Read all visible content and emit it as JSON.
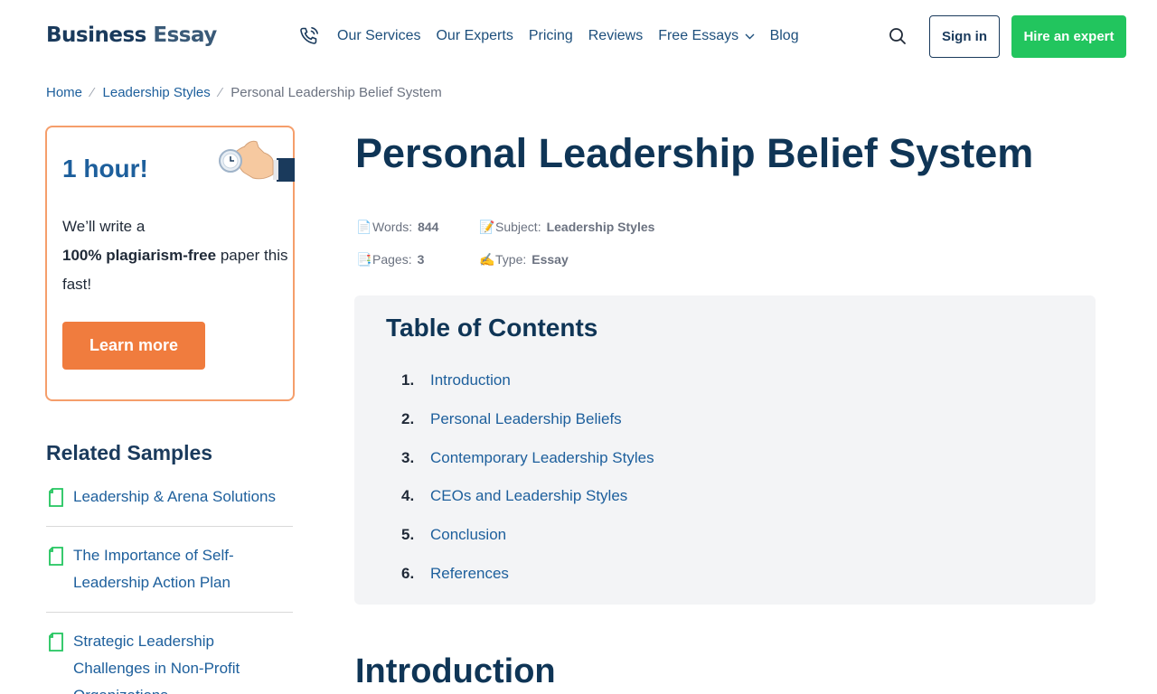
{
  "header": {
    "logo_part1": "Business",
    "logo_part2": "Essay",
    "nav": [
      {
        "label": "Our Services"
      },
      {
        "label": "Our Experts"
      },
      {
        "label": "Pricing"
      },
      {
        "label": "Reviews"
      },
      {
        "label": "Free Essays"
      },
      {
        "label": "Blog"
      }
    ],
    "signin_label": "Sign in",
    "hire_label": "Hire an expert",
    "icons": [
      "phone-icon",
      "search-icon",
      "chevron-down-icon"
    ]
  },
  "breadcrumb": {
    "items": [
      "Home",
      "Leadership Styles"
    ],
    "current": "Personal Leadership Belief System",
    "separator": "⁄"
  },
  "promo": {
    "title": "1 hour!",
    "text_1": "We’ll write a",
    "text_bold": "100% plagiarism-free",
    "text_2": "paper this fast!",
    "button_label": "Learn more"
  },
  "related": {
    "title": "Related Samples",
    "items": [
      {
        "label": "Leadership & Arena Solutions"
      },
      {
        "label": "The Importance of Self-Leadership Action Plan"
      },
      {
        "label": "Strategic Leadership Challenges in Non-Profit Organizations"
      }
    ]
  },
  "article": {
    "title": "Personal Leadership Belief System",
    "meta": {
      "words_label": "Words:",
      "words_value": "844",
      "subject_label": "Subject:",
      "subject_value": "Leadership Styles",
      "pages_label": "Pages:",
      "pages_value": "3",
      "type_label": "Type:",
      "type_value": "Essay"
    },
    "toc": {
      "title": "Table of Contents",
      "items": [
        {
          "num": "1.",
          "label": "Introduction"
        },
        {
          "num": "2.",
          "label": "Personal Leadership Beliefs"
        },
        {
          "num": "3.",
          "label": "Contemporary Leadership Styles"
        },
        {
          "num": "4.",
          "label": "CEOs and Leadership Styles"
        },
        {
          "num": "5.",
          "label": "Conclusion"
        },
        {
          "num": "6.",
          "label": "References"
        }
      ]
    },
    "section_heading": "Introduction"
  },
  "colors": {
    "brand_navy": "#0f3556",
    "link_blue": "#1d5f9c",
    "hire_green": "#22c55e",
    "promo_orange": "#f07c3e",
    "toc_bg": "#f3f4f6"
  }
}
